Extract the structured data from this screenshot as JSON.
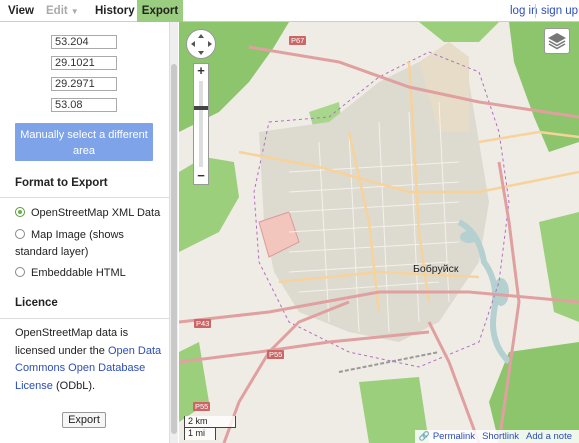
{
  "nav": {
    "view": "View",
    "edit": "Edit",
    "history": "History",
    "export": "Export",
    "login": "log in",
    "signup": "sign up"
  },
  "sidebar": {
    "coords": [
      "53.204",
      "29.1021",
      "29.2971",
      "53.08"
    ],
    "manual_select": "Manually select a different area",
    "format_title": "Format to Export",
    "formats": [
      {
        "label": "OpenStreetMap XML Data",
        "selected": true
      },
      {
        "label": "Map Image (shows standard layer)",
        "selected": false
      },
      {
        "label": "Embeddable HTML",
        "selected": false
      }
    ],
    "licence_title": "Licence",
    "licence_prefix": "OpenStreetMap data is licensed under the ",
    "licence_link": "Open Data Commons Open Database License",
    "licence_suffix": " (ODbL).",
    "export_button": "Export"
  },
  "map": {
    "city_label": "Бобруйск",
    "road_labels": [
      "P67",
      "P43",
      "P55",
      "P55"
    ],
    "scale_km": "2 km",
    "scale_mi": "1 mi",
    "footer": {
      "permalink": "Permalink",
      "shortlink": "Shortlink",
      "add_note": "Add a note"
    },
    "colors": {
      "background": "#efece5",
      "forest": "#8dc56c",
      "urban": "#dddad0",
      "road_major": "#e0a0a0",
      "road_secondary": "#f7d39c",
      "water": "#b5d0d0",
      "boundary": "#b070c0"
    }
  }
}
